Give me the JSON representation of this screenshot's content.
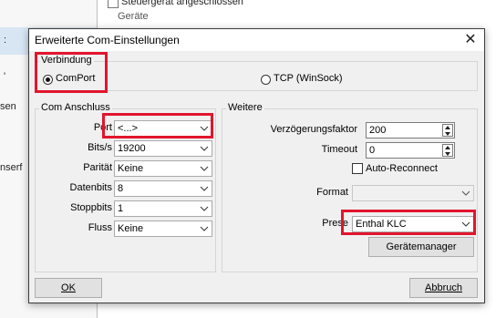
{
  "background": {
    "left_items": [
      ":",
      "'",
      "sen",
      "nserf"
    ],
    "top_text": "Steuergerät angeschlossen",
    "section_label": "Geräte"
  },
  "dialog": {
    "title": "Erweiterte Com-Einstellungen",
    "close_glyph": "✕",
    "verbindung": {
      "group_label": "Verbindung",
      "comport_label": "ComPort",
      "tcp_label": "TCP (WinSock)",
      "selected": "ComPort"
    },
    "com_anschluss": {
      "group_label": "Com Anschluss",
      "port_label": "Port",
      "port_value": "<...>",
      "bits_label": "Bits/s",
      "bits_value": "19200",
      "paritaet_label": "Parität",
      "paritaet_value": "Keine",
      "datenbits_label": "Datenbits",
      "datenbits_value": "8",
      "stoppbits_label": "Stoppbits",
      "stoppbits_value": "1",
      "fluss_label": "Fluss",
      "fluss_value": "Keine"
    },
    "weitere": {
      "group_label": "Weitere",
      "verzoegerung_label": "Verzögerungsfaktor",
      "verzoegerung_value": "200",
      "timeout_label": "Timeout",
      "timeout_value": "0",
      "auto_reconnect_label": "Auto-Reconnect",
      "auto_reconnect_checked": false,
      "format_label": "Format",
      "format_value": "",
      "preset_label": "Prese",
      "preset_value": "Enthal KLC",
      "geraetemanager_label": "Gerätemanager"
    },
    "buttons": {
      "ok_label": "OK",
      "abbruch_label": "Abbruch"
    }
  },
  "colors": {
    "highlight": "#e2152d",
    "dialog_bg": "#f0f0f0"
  }
}
